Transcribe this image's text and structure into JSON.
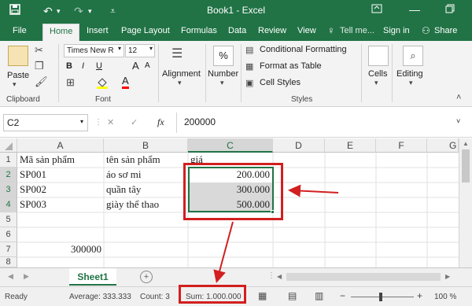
{
  "titlebar": {
    "title": "Book1 - Excel",
    "save_icon": "save-icon",
    "undo_icon": "undo-icon",
    "redo_icon": "redo-icon",
    "customize_icon": "customize-qat-icon",
    "ribbon_options_icon": "ribbon-options-icon",
    "minimize_icon": "minimize-icon",
    "maximize_icon": "maximize-icon"
  },
  "tabs": [
    "File",
    "Home",
    "Insert",
    "Page Layout",
    "Formulas",
    "Data",
    "Review",
    "View"
  ],
  "tell_me": "Tell me...",
  "sign_in": "Sign in",
  "share": "Share",
  "ribbon": {
    "clipboard": {
      "paste": "Paste",
      "label": "Clipboard"
    },
    "font": {
      "name": "Times New R",
      "size": "12",
      "label": "Font",
      "bold": "B",
      "italic": "I",
      "underline": "U",
      "grow": "A",
      "shrink": "A",
      "font_color": "A"
    },
    "alignment": {
      "label": "Alignment"
    },
    "number": {
      "label": "Number",
      "symbol": "%"
    },
    "styles": {
      "conditional": "Conditional Formatting",
      "format_table": "Format as Table",
      "cell_styles": "Cell Styles",
      "label": "Styles"
    },
    "cells": {
      "label": "Cells"
    },
    "editing": {
      "label": "Editing"
    }
  },
  "formula_bar": {
    "name_box": "C2",
    "cancel": "✕",
    "enter": "✓",
    "fx": "fx",
    "value": "200000"
  },
  "grid": {
    "columns": [
      "A",
      "B",
      "C",
      "D",
      "E",
      "F",
      "G"
    ],
    "rows": [
      "1",
      "2",
      "3",
      "4",
      "5",
      "6",
      "7",
      "8"
    ],
    "cells": {
      "a1": "Mã sản phẩm",
      "b1": "tên sản phẩm",
      "c1": "giá",
      "a2": "SP001",
      "b2": "áo sơ mi",
      "c2": "200.000",
      "a3": "SP002",
      "b3": "quần tây",
      "c3": "300.000",
      "a4": "SP003",
      "b4": "giày thể thao",
      "c4": "500.000",
      "a7": "300000"
    }
  },
  "sheet_tab": "Sheet1",
  "status": {
    "ready": "Ready",
    "average": "Average: 333.333",
    "count": "Count: 3",
    "sum": "Sum: 1.000.000",
    "zoom": "100 %",
    "minus": "−",
    "plus": "+"
  },
  "colors": {
    "excel_green": "#217346",
    "annotation_red": "#d21f1f"
  }
}
